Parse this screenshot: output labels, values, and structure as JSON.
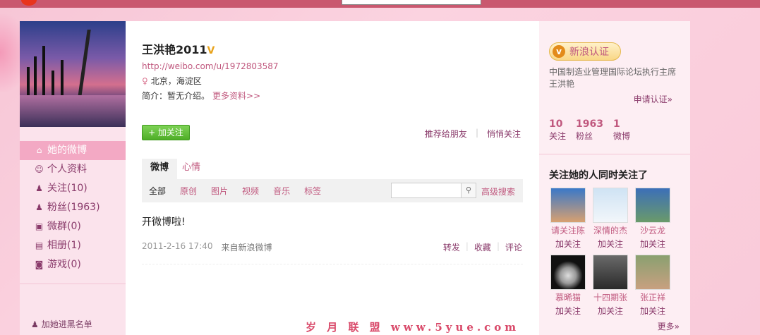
{
  "profile": {
    "name": "王洪艳2011",
    "verified_mark": "V",
    "url": "http://weibo.com/u/1972803587",
    "location": "北京，海淀区",
    "intro": "简介：暂无介绍。",
    "more_info": "更多资料>>",
    "follow_button": "+ 加关注",
    "recommend": "推荐给朋友",
    "secret_follow": "悄悄关注"
  },
  "sidebar": {
    "items": [
      {
        "label": "她的微博",
        "icon": "home-icon"
      },
      {
        "label": "个人资料",
        "icon": "profile-icon"
      },
      {
        "label": "关注(10)",
        "icon": "follow-icon"
      },
      {
        "label": "粉丝(1963)",
        "icon": "fans-icon"
      },
      {
        "label": "微群(0)",
        "icon": "group-icon"
      },
      {
        "label": "相册(1)",
        "icon": "album-icon"
      },
      {
        "label": "游戏(0)",
        "icon": "game-icon"
      }
    ],
    "blacklist": "加她进黑名单"
  },
  "tabs": {
    "active": "微博",
    "inactive": "心情"
  },
  "filters": [
    "全部",
    "原创",
    "图片",
    "视频",
    "音乐",
    "标签"
  ],
  "advanced_search": "高级搜索",
  "post": {
    "text": "开微博啦!",
    "time": "2011-2-16 17:40",
    "source": "来自新浪微博",
    "actions": [
      "转发",
      "收藏",
      "评论"
    ]
  },
  "right": {
    "verify_label": "新浪认证",
    "verify_desc": "中国制造业管理国际论坛执行主席王洪艳",
    "apply": "申请认证»",
    "stats": [
      {
        "num": "10",
        "label": "关注"
      },
      {
        "num": "1963",
        "label": "粉丝"
      },
      {
        "num": "1",
        "label": "微博"
      }
    ],
    "also_follow_title": "关注她的人同时关注了",
    "users": [
      {
        "name": "请关注陈",
        "follow": "加关注"
      },
      {
        "name": "深情的杰",
        "follow": "加关注"
      },
      {
        "name": "沙云龙",
        "follow": "加关注"
      },
      {
        "name": "慕晞猫",
        "follow": "加关注"
      },
      {
        "name": "十四期张",
        "follow": "加关注"
      },
      {
        "name": "张正祥",
        "follow": "加关注"
      }
    ],
    "more": "更多»"
  },
  "watermark": "岁 月 联 盟  www.5yue.com"
}
